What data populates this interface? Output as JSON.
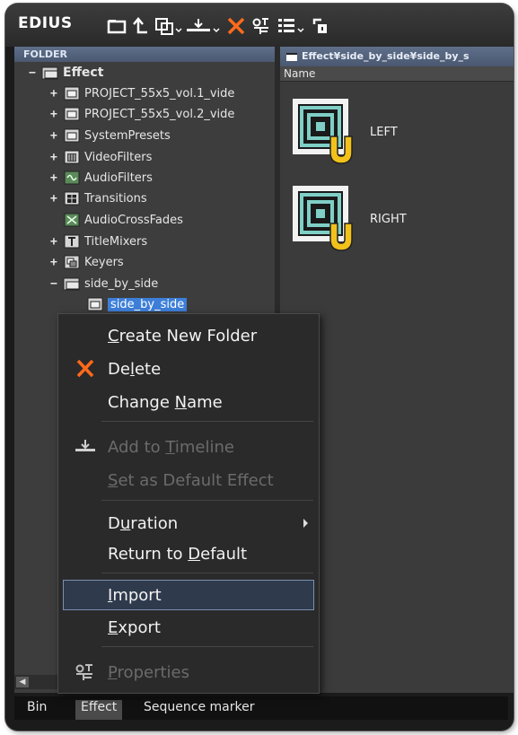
{
  "app": {
    "title": "EDIUS"
  },
  "toolbar": {
    "icons": [
      "new-folder-icon",
      "up-folder-icon",
      "copy-icon",
      "add-to-timeline-icon",
      "delete-icon",
      "properties-icon",
      "view-mode-icon",
      "lock-icon"
    ]
  },
  "folder_pane": {
    "header": "FOLDER",
    "tree": [
      {
        "toggle": "−",
        "label": "Effect",
        "icon": "folder-open-icon",
        "depth": 0
      },
      {
        "toggle": "+",
        "label": "PROJECT_55x5_vol.1_vide",
        "icon": "folder-icon",
        "depth": 1
      },
      {
        "toggle": "+",
        "label": "PROJECT_55x5_vol.2_vide",
        "icon": "folder-icon",
        "depth": 1
      },
      {
        "toggle": "+",
        "label": "SystemPresets",
        "icon": "folder-icon",
        "depth": 1
      },
      {
        "toggle": "+",
        "label": "VideoFilters",
        "icon": "video-filter-icon",
        "depth": 1
      },
      {
        "toggle": "+",
        "label": "AudioFilters",
        "icon": "audio-filter-icon",
        "depth": 1
      },
      {
        "toggle": "+",
        "label": "Transitions",
        "icon": "transition-icon",
        "depth": 1
      },
      {
        "toggle": "",
        "label": "AudioCrossFades",
        "icon": "audio-crossfade-icon",
        "depth": 1
      },
      {
        "toggle": "+",
        "label": "TitleMixers",
        "icon": "title-mixer-icon",
        "depth": 1
      },
      {
        "toggle": "+",
        "label": "Keyers",
        "icon": "keyer-icon",
        "depth": 1
      },
      {
        "toggle": "−",
        "label": "side_by_side",
        "icon": "folder-open-icon",
        "depth": 1
      },
      {
        "toggle": "",
        "label": "side_by_side",
        "icon": "folder-icon",
        "depth": 2,
        "selected": true
      }
    ]
  },
  "view_pane": {
    "path": "Effect¥side_by_side¥side_by_s",
    "column_name": "Name",
    "items": [
      {
        "label": "LEFT"
      },
      {
        "label": "RIGHT"
      }
    ]
  },
  "context_menu": {
    "items": [
      {
        "pre": "",
        "u": "C",
        "post": "reate New Folder",
        "enabled": true
      },
      {
        "pre": "De",
        "u": "l",
        "post": "ete",
        "enabled": true,
        "icon": "delete-icon"
      },
      {
        "pre": "Change ",
        "u": "N",
        "post": "ame",
        "enabled": true
      },
      {
        "pre": "Add to ",
        "u": "T",
        "post": "imeline",
        "enabled": false,
        "icon": "add-to-timeline-icon"
      },
      {
        "pre": "",
        "u": "S",
        "post": "et as Default Effect",
        "enabled": false
      },
      {
        "pre": "D",
        "u": "u",
        "post": "ration",
        "enabled": true,
        "submenu": true
      },
      {
        "pre": "Return to ",
        "u": "D",
        "post": "efault",
        "enabled": true
      },
      {
        "pre": "",
        "u": "I",
        "post": "mport",
        "enabled": true,
        "highlighted": true
      },
      {
        "pre": "",
        "u": "E",
        "post": "xport",
        "enabled": true
      },
      {
        "pre": "",
        "u": "P",
        "post": "roperties",
        "enabled": false,
        "icon": "properties-icon"
      }
    ]
  },
  "tabs": [
    {
      "label": "Bin",
      "active": false
    },
    {
      "label": "Effect",
      "active": true
    },
    {
      "label": "Sequence marker",
      "active": false
    }
  ]
}
